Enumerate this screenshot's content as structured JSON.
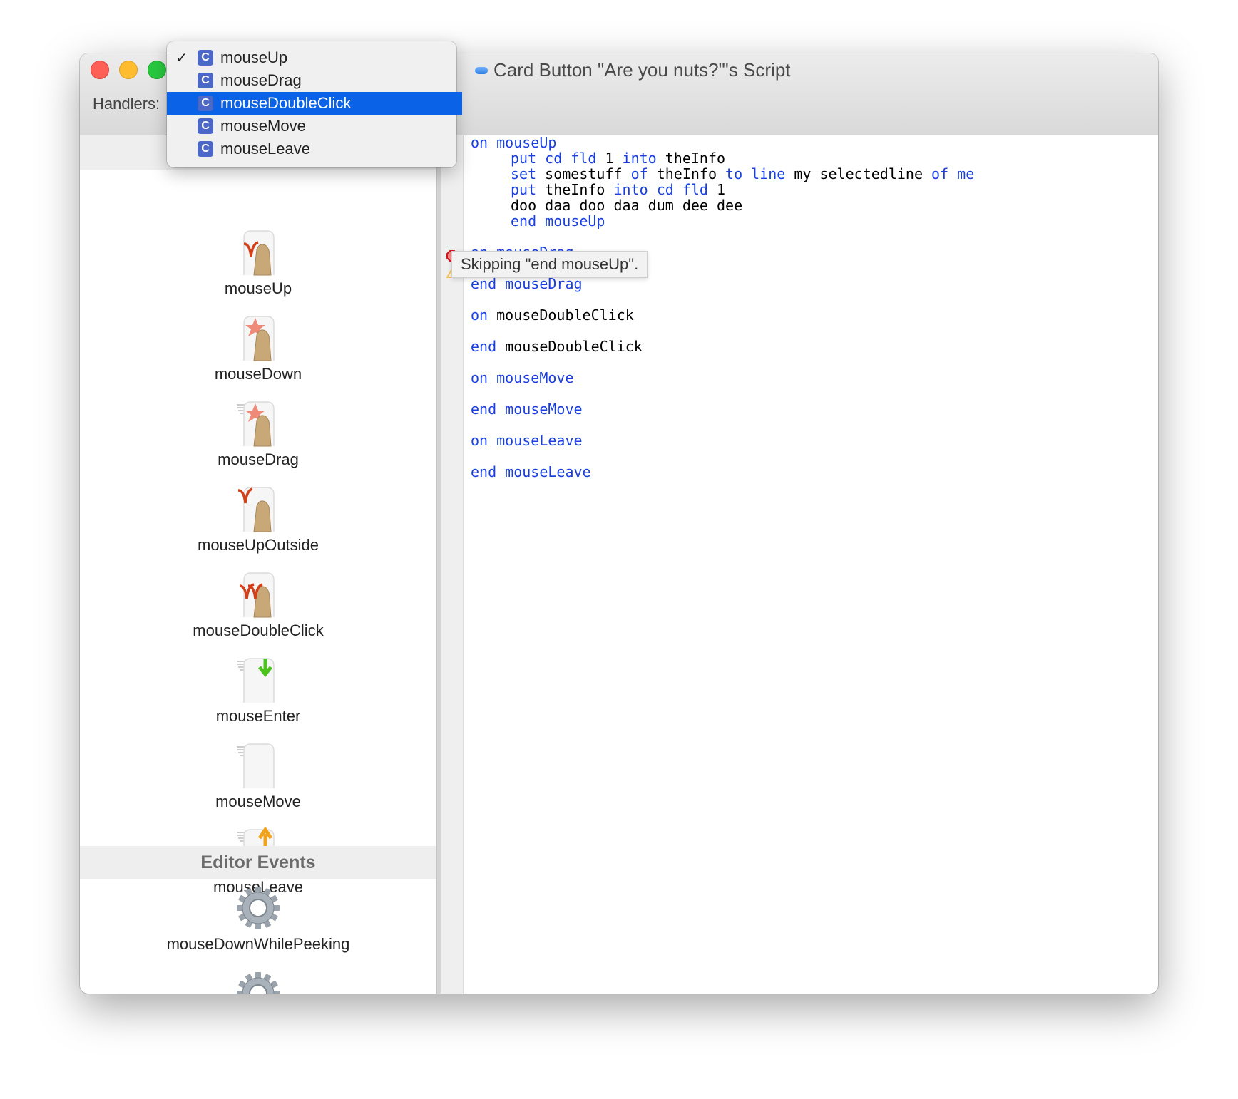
{
  "window": {
    "title": "Card Button \"Are you nuts?\"'s Script",
    "handlers_label": "Handlers:"
  },
  "handlers_menu": {
    "items": [
      {
        "label": "mouseUp",
        "checked": true,
        "selected": false,
        "badge": "C"
      },
      {
        "label": "mouseDrag",
        "checked": false,
        "selected": false,
        "badge": "C"
      },
      {
        "label": "mouseDoubleClick",
        "checked": false,
        "selected": true,
        "badge": "C"
      },
      {
        "label": "mouseMove",
        "checked": false,
        "selected": false,
        "badge": "C"
      },
      {
        "label": "mouseLeave",
        "checked": false,
        "selected": false,
        "badge": "C"
      }
    ],
    "check_glyph": "✓",
    "accent": "#0a63e6"
  },
  "sidebar": {
    "items": [
      {
        "label": "mouseUp",
        "icon": "finger-up-icon"
      },
      {
        "label": "mouseDown",
        "icon": "finger-down-icon"
      },
      {
        "label": "mouseDrag",
        "icon": "finger-drag-icon"
      },
      {
        "label": "mouseUpOutside",
        "icon": "finger-up-outside-icon"
      },
      {
        "label": "mouseDoubleClick",
        "icon": "finger-double-click-icon"
      },
      {
        "label": "mouseEnter",
        "icon": "mouse-enter-icon"
      },
      {
        "label": "mouseMove",
        "icon": "mouse-move-icon"
      },
      {
        "label": "mouseLeave",
        "icon": "mouse-leave-icon"
      }
    ],
    "section_header": "Editor Events",
    "editor_items": [
      {
        "label": "mouseDownWhilePeeking",
        "icon": "gear-icon"
      },
      {
        "label": "",
        "icon": "gear-icon"
      }
    ]
  },
  "script": {
    "keyword_color": "#1a3fe0",
    "lines": [
      {
        "indent": 0,
        "tokens": [
          [
            "on",
            "kw"
          ],
          [
            " ",
            ""
          ],
          [
            "mouseUp",
            "kw"
          ]
        ]
      },
      {
        "indent": 1,
        "tokens": [
          [
            "put cd fld",
            "kw"
          ],
          [
            " 1 ",
            ""
          ],
          [
            "into",
            "kw"
          ],
          [
            " theInfo",
            ""
          ]
        ]
      },
      {
        "indent": 1,
        "tokens": [
          [
            "set",
            "kw"
          ],
          [
            " somestuff ",
            ""
          ],
          [
            "of",
            "kw"
          ],
          [
            " theInfo ",
            ""
          ],
          [
            "to line",
            "kw"
          ],
          [
            " my selectedline ",
            ""
          ],
          [
            "of me",
            "kw"
          ]
        ]
      },
      {
        "indent": 1,
        "tokens": [
          [
            "put",
            "kw"
          ],
          [
            " theInfo ",
            ""
          ],
          [
            "into cd fld",
            "kw"
          ],
          [
            " 1",
            ""
          ]
        ]
      },
      {
        "indent": 1,
        "tokens": [
          [
            "doo daa doo daa dum dee dee",
            ""
          ]
        ]
      },
      {
        "indent": 1,
        "tokens": [
          [
            "end mouseUp",
            "kw"
          ]
        ]
      },
      {
        "indent": 0,
        "tokens": []
      },
      {
        "indent": 0,
        "tokens": [
          [
            "on mouseDrag",
            "kw"
          ]
        ]
      },
      {
        "indent": 0,
        "tokens": []
      },
      {
        "indent": 0,
        "tokens": [
          [
            "end mouseDrag",
            "kw"
          ]
        ]
      },
      {
        "indent": 0,
        "tokens": []
      },
      {
        "indent": 0,
        "tokens": [
          [
            "on",
            "kw"
          ],
          [
            " mouseDoubleClick",
            ""
          ]
        ]
      },
      {
        "indent": 0,
        "tokens": []
      },
      {
        "indent": 0,
        "tokens": [
          [
            "end",
            "kw"
          ],
          [
            " mouseDoubleClick",
            ""
          ]
        ]
      },
      {
        "indent": 0,
        "tokens": []
      },
      {
        "indent": 0,
        "tokens": [
          [
            "on mouseMove",
            "kw"
          ]
        ]
      },
      {
        "indent": 0,
        "tokens": []
      },
      {
        "indent": 0,
        "tokens": [
          [
            "end mouseMove",
            "kw"
          ]
        ]
      },
      {
        "indent": 0,
        "tokens": []
      },
      {
        "indent": 0,
        "tokens": [
          [
            "on mouseLeave",
            "kw"
          ]
        ]
      },
      {
        "indent": 0,
        "tokens": []
      },
      {
        "indent": 0,
        "tokens": [
          [
            "end mouseLeave",
            "kw"
          ]
        ]
      }
    ],
    "markers": [
      {
        "line": 5,
        "type": "error-icon"
      },
      {
        "line": 6,
        "type": "warning-icon"
      }
    ],
    "tooltip": "Skipping \"end mouseUp\"."
  }
}
